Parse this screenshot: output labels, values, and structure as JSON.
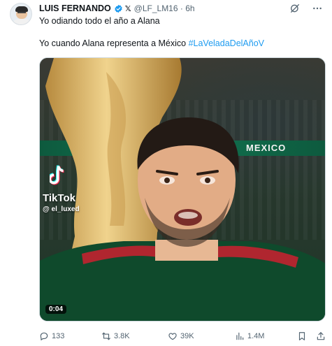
{
  "author": {
    "name": "LUIS FERNANDO",
    "handle_time": "@LF_LM16 · 6h"
  },
  "tweet": {
    "line1": "Yo odiando todo el año a Alana",
    "line2_text": "Yo cuando Alana representa a México ",
    "hashtag": "#LaVeladaDelAñoV"
  },
  "media": {
    "banner_text": "MEXICO",
    "watermark_brand": "TikTok",
    "watermark_user": "@ el_luxed",
    "video_time": "0:04"
  },
  "actions": {
    "replies": "133",
    "reposts": "3.8K",
    "likes": "39K",
    "views": "1.4M"
  },
  "colors": {
    "accent": "#1d9bf0",
    "icon": "#536471",
    "verified": "#1d9bf0",
    "banner": "#117552"
  },
  "icons": [
    "verified-badge-icon",
    "x-logo-icon",
    "grok-icon",
    "more-icon",
    "reply-icon",
    "repost-icon",
    "like-icon",
    "views-icon",
    "bookmark-icon",
    "share-icon",
    "tiktok-icon"
  ]
}
